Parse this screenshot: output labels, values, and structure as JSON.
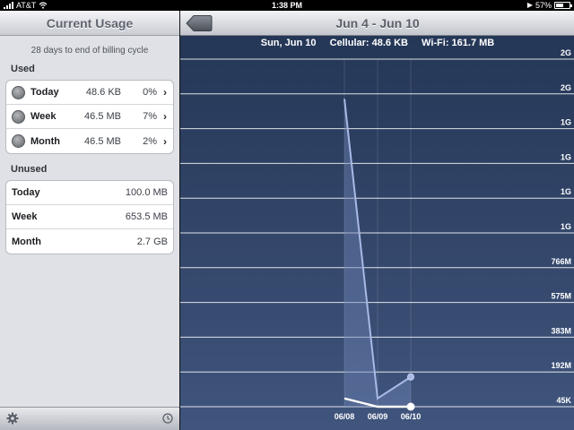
{
  "status_bar": {
    "carrier": "AT&T",
    "time": "1:38 PM",
    "battery": "57%",
    "battery_level": 0.57
  },
  "left_panel": {
    "title": "Current Usage",
    "cycle_note": "28 days to end of billing cycle",
    "used_title": "Used",
    "used_rows": [
      {
        "label": "Today",
        "value": "48.6 KB",
        "percent": "0%"
      },
      {
        "label": "Week",
        "value": "46.5 MB",
        "percent": "7%"
      },
      {
        "label": "Month",
        "value": "46.5 MB",
        "percent": "2%"
      }
    ],
    "unused_title": "Unused",
    "unused_rows": [
      {
        "label": "Today",
        "value": "100.0 MB"
      },
      {
        "label": "Week",
        "value": "653.5 MB"
      },
      {
        "label": "Month",
        "value": "2.7 GB"
      }
    ],
    "footer_icons": [
      "gear-icon",
      "clock-icon"
    ]
  },
  "right_panel": {
    "title": "Jun 4 - Jun 10",
    "info": {
      "date": "Sun, Jun 10",
      "cellular": "Cellular: 48.6 KB",
      "wifi": "Wi-Fi: 161.7 MB"
    },
    "back_icon": "back-arrow-icon"
  },
  "chart_data": {
    "type": "line",
    "title": "",
    "xlabel": "",
    "ylabel": "",
    "grid": true,
    "y_tick_labels": [
      "45K",
      "192M",
      "383M",
      "575M",
      "766M",
      "1G",
      "1G",
      "1G",
      "1G",
      "2G",
      "2G"
    ],
    "categories": [
      "06/08",
      "06/09",
      "06/10"
    ],
    "series": [
      {
        "values": [
          1.86,
          0.05,
          0.18
        ],
        "color": "#a9b9e6"
      },
      {
        "values": [
          0.05,
          0.0,
          0.0
        ],
        "color": "#ffffff"
      }
    ],
    "ylim": [
      0,
      2.1
    ],
    "colors": {
      "grid": "#ffffff",
      "area": "#6d82b3"
    }
  }
}
